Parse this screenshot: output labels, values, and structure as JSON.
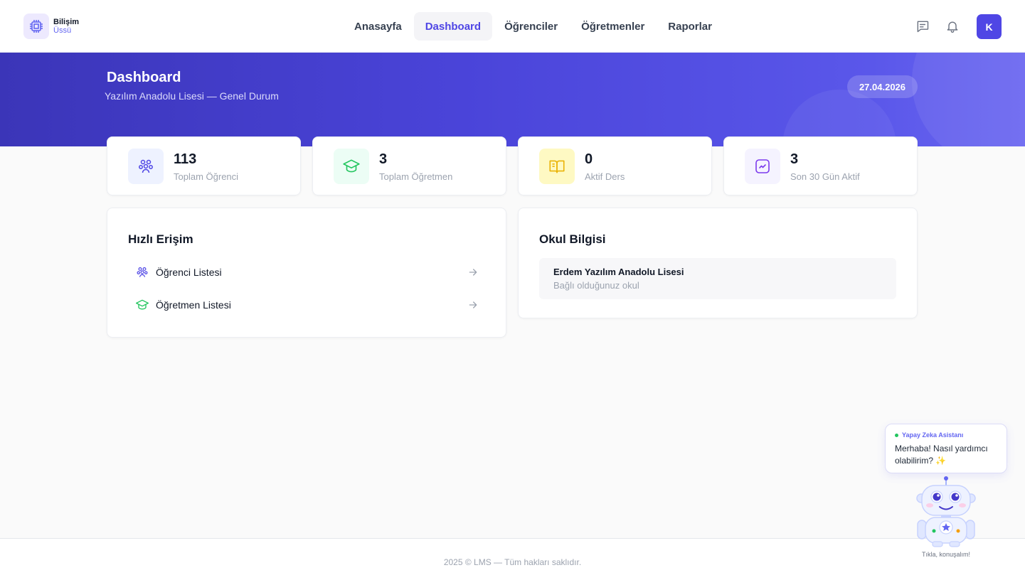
{
  "brand": {
    "title": "Bilişim",
    "subtitle": "Üssü"
  },
  "nav": {
    "items": [
      {
        "label": "Anasayfa",
        "active": false
      },
      {
        "label": "Dashboard",
        "active": true
      },
      {
        "label": "Öğrenciler",
        "active": false
      },
      {
        "label": "Öğretmenler",
        "active": false
      },
      {
        "label": "Raporlar",
        "active": false
      }
    ]
  },
  "header": {
    "avatar_initial": "K",
    "icons": [
      "message-icon",
      "bell-icon"
    ]
  },
  "banner": {
    "title": "Dashboard",
    "subtitle": "Yazılım Anadolu Lisesi — Genel Durum",
    "date": "27.04.2026"
  },
  "stats": [
    {
      "value": "113",
      "label": "Toplam Öğrenci",
      "icon": "users-icon",
      "color": "#4f46e5",
      "bg": "#eef2ff"
    },
    {
      "value": "3",
      "label": "Toplam Öğretmen",
      "icon": "graduation-cap-icon",
      "color": "#22c55e",
      "bg": "#ecfdf5"
    },
    {
      "value": "0",
      "label": "Aktif Ders",
      "icon": "book-open-icon",
      "color": "#eab308",
      "bg": "#fef9c3"
    },
    {
      "value": "3",
      "label": "Son 30 Gün Aktif",
      "icon": "activity-icon",
      "color": "#7c3aed",
      "bg": "#f5f3ff"
    }
  ],
  "quick_access": {
    "title": "Hızlı Erişim",
    "items": [
      {
        "label": "Öğrenci Listesi",
        "icon": "users-icon"
      },
      {
        "label": "Öğretmen Listesi",
        "icon": "graduation-cap-icon"
      }
    ]
  },
  "school": {
    "title": "Okul Bilgisi",
    "name": "Erdem Yazılım Anadolu Lisesi",
    "note": "Bağlı olduğunuz okul"
  },
  "assistant": {
    "name": "Yapay Zeka Asistanı",
    "message": "Merhaba! Nasıl yardımcı olabilirim?",
    "emoji": "✨",
    "caption": "Tıkla, konuşalım!"
  },
  "footer": {
    "text": "2025 © LMS — Tüm hakları saklıdır."
  },
  "colors": {
    "primary": "#4f46e5",
    "banner_start": "#3b35b8",
    "banner_end": "#6a66f0"
  }
}
